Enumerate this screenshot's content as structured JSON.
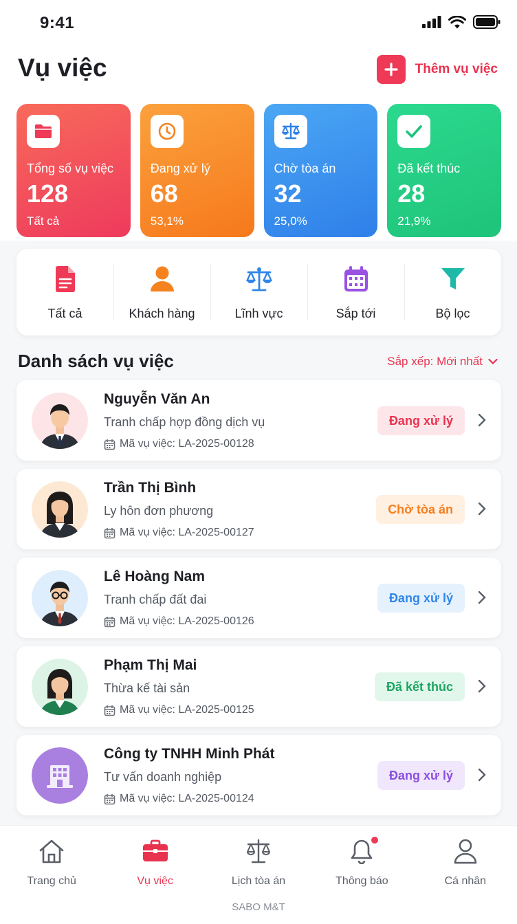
{
  "status_bar": {
    "time": "9:41"
  },
  "header": {
    "title": "Vụ việc",
    "add_label": "Thêm vụ việc"
  },
  "stats": [
    {
      "label": "Tổng số vụ việc",
      "value": "128",
      "sub": "Tất cả",
      "icon": "folder-icon"
    },
    {
      "label": "Đang xử lý",
      "value": "68",
      "sub": "53,1%",
      "icon": "clock-icon"
    },
    {
      "label": "Chờ tòa án",
      "value": "32",
      "sub": "25,0%",
      "icon": "scale-icon"
    },
    {
      "label": "Đã kết thúc",
      "value": "28",
      "sub": "21,9%",
      "icon": "check-icon"
    }
  ],
  "quick_filters": [
    {
      "label": "Tất cả",
      "icon": "document-icon"
    },
    {
      "label": "Khách hàng",
      "icon": "user-icon"
    },
    {
      "label": "Lĩnh vực",
      "icon": "scale-icon"
    },
    {
      "label": "Sắp tới",
      "icon": "calendar-icon"
    },
    {
      "label": "Bộ lọc",
      "icon": "filter-icon"
    }
  ],
  "list": {
    "title": "Danh sách vụ việc",
    "sort_label": "Sắp xếp: Mới nhất"
  },
  "cases": [
    {
      "name": "Nguyễn Văn An",
      "type": "Tranh chấp hợp đồng dịch vụ",
      "code": "Mã vụ việc: LA-2025-00128",
      "status": "Đang xử lý"
    },
    {
      "name": "Trần Thị Bình",
      "type": "Ly hôn đơn phương",
      "code": "Mã vụ việc: LA-2025-00127",
      "status": "Chờ tòa án"
    },
    {
      "name": "Lê Hoàng Nam",
      "type": "Tranh chấp đất đai",
      "code": "Mã vụ việc: LA-2025-00126",
      "status": "Đang xử lý"
    },
    {
      "name": "Phạm Thị Mai",
      "type": "Thừa kế tài sản",
      "code": "Mã vụ việc: LA-2025-00125",
      "status": "Đã kết thúc"
    },
    {
      "name": "Công ty TNHH Minh Phát",
      "type": "Tư vấn doanh nghiệp",
      "code": "Mã vụ việc: LA-2025-00124",
      "status": "Đang xử lý"
    }
  ],
  "bottom_nav": [
    {
      "label": "Trang chủ",
      "icon": "home-icon"
    },
    {
      "label": "Vụ việc",
      "icon": "briefcase-icon",
      "active": true
    },
    {
      "label": "Lịch tòa án",
      "icon": "scale-icon"
    },
    {
      "label": "Thông báo",
      "icon": "bell-icon"
    },
    {
      "label": "Cá nhân",
      "icon": "user-icon"
    }
  ],
  "brand": "SABO M&T",
  "colors": {
    "accent": "#e8334f",
    "orange": "#f6791c",
    "blue": "#2f7fe9",
    "green": "#1fc37a",
    "purple": "#8b4fe0"
  }
}
